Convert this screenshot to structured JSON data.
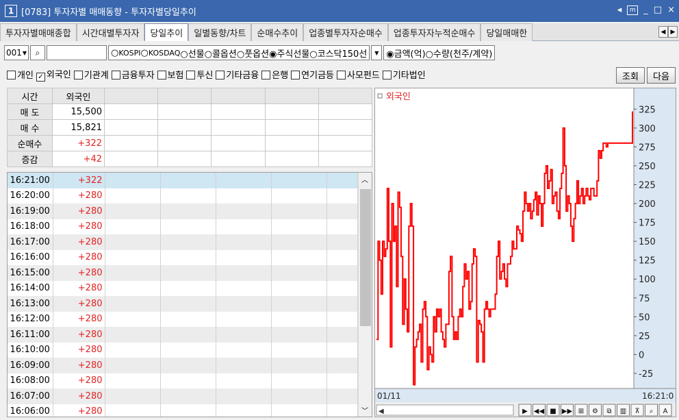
{
  "window": {
    "num": "1",
    "title": "[0783] 투자자별 매매동향 - 투자자별당일추이"
  },
  "tabs": [
    "투자자별매매종합",
    "시간대별투자자",
    "당일추이",
    "일별동향/차트",
    "순매수추이",
    "업종별투자자순매수",
    "업종투자자누적순매수",
    "당일매매한"
  ],
  "active_tab": 2,
  "controls": {
    "code": "001",
    "market_options": [
      "KOSPI",
      "KOSDAQ",
      "선물",
      "콜옵션",
      "풋옵션",
      "주식선물",
      "코스닥150선"
    ],
    "market_selected": "주식선물",
    "unit_options": [
      "금액(억)",
      "수량(천주/계약)"
    ],
    "unit_selected": "금액(억)"
  },
  "investors": [
    {
      "label": "개인",
      "checked": false
    },
    {
      "label": "외국인",
      "checked": true
    },
    {
      "label": "기관계",
      "checked": false
    },
    {
      "label": "금융투자",
      "checked": false
    },
    {
      "label": "보험",
      "checked": false
    },
    {
      "label": "투신",
      "checked": false
    },
    {
      "label": "기타금융",
      "checked": false
    },
    {
      "label": "은행",
      "checked": false
    },
    {
      "label": "연기금등",
      "checked": false
    },
    {
      "label": "사모펀드",
      "checked": false
    },
    {
      "label": "기타법인",
      "checked": false
    }
  ],
  "buttons": {
    "query": "조회",
    "next": "다음"
  },
  "summary": {
    "header": [
      "시간",
      "외국인"
    ],
    "rows": [
      {
        "label": "매 도",
        "value": "15,500"
      },
      {
        "label": "매 수",
        "value": "15,821"
      },
      {
        "label": "순매수",
        "value": "+322"
      },
      {
        "label": "증감",
        "value": "+42"
      }
    ]
  },
  "timeseries": [
    {
      "time": "16:21:00",
      "value": "+322"
    },
    {
      "time": "16:20:00",
      "value": "+280"
    },
    {
      "time": "16:19:00",
      "value": "+280"
    },
    {
      "time": "16:18:00",
      "value": "+280"
    },
    {
      "time": "16:17:00",
      "value": "+280"
    },
    {
      "time": "16:16:00",
      "value": "+280"
    },
    {
      "time": "16:15:00",
      "value": "+280"
    },
    {
      "time": "16:14:00",
      "value": "+280"
    },
    {
      "time": "16:13:00",
      "value": "+280"
    },
    {
      "time": "16:12:00",
      "value": "+280"
    },
    {
      "time": "16:11:00",
      "value": "+280"
    },
    {
      "time": "16:10:00",
      "value": "+280"
    },
    {
      "time": "16:09:00",
      "value": "+280"
    },
    {
      "time": "16:08:00",
      "value": "+280"
    },
    {
      "time": "16:07:00",
      "value": "+280"
    },
    {
      "time": "16:06:00",
      "value": "+280"
    }
  ],
  "chart_data": {
    "type": "line",
    "legend": "외국인",
    "color": "#ff0000",
    "y_ticks": [
      325,
      300,
      275,
      250,
      225,
      200,
      175,
      150,
      125,
      100,
      75,
      50,
      25,
      0,
      -25
    ],
    "ylim": [
      -45,
      338
    ],
    "x_start_label": "01/11",
    "x_end_label": "16:21:0",
    "series": [
      {
        "values": [
          20,
          150,
          125,
          80,
          150,
          130,
          140,
          220,
          150,
          10,
          200,
          150,
          170,
          90,
          215,
          195,
          130,
          40,
          100,
          60,
          30,
          170,
          200,
          170,
          -40,
          10,
          20,
          30,
          40,
          -10,
          60,
          70,
          50,
          -20,
          10,
          0,
          -10,
          50,
          30,
          60,
          50,
          60,
          30,
          20,
          10,
          40,
          40,
          110,
          130,
          50,
          20,
          30,
          20,
          50,
          60,
          50,
          90,
          120,
          100,
          110,
          60,
          70,
          120,
          140,
          130,
          -10,
          45,
          40,
          30,
          -10,
          60,
          70,
          60,
          50,
          60,
          60,
          60,
          80,
          130,
          150,
          100,
          110,
          120,
          100,
          90,
          120,
          120,
          130,
          150,
          140,
          140,
          170,
          165,
          160,
          150,
          190,
          215,
          200,
          190,
          200,
          180,
          190,
          205,
          215,
          185,
          210,
          200,
          170,
          200,
          240,
          250,
          220,
          230,
          245,
          200,
          210,
          215,
          190,
          180,
          220,
          240,
          300,
          250,
          190,
          210,
          200,
          170,
          150,
          180,
          200,
          230,
          200,
          210,
          220,
          200,
          210,
          220,
          210,
          205,
          220,
          220,
          210,
          210,
          230,
          270,
          260,
          270,
          280,
          280,
          275,
          280,
          280,
          280,
          280,
          280,
          280,
          280,
          280,
          280,
          280,
          280,
          280,
          280,
          280,
          280,
          280,
          322
        ]
      }
    ]
  }
}
